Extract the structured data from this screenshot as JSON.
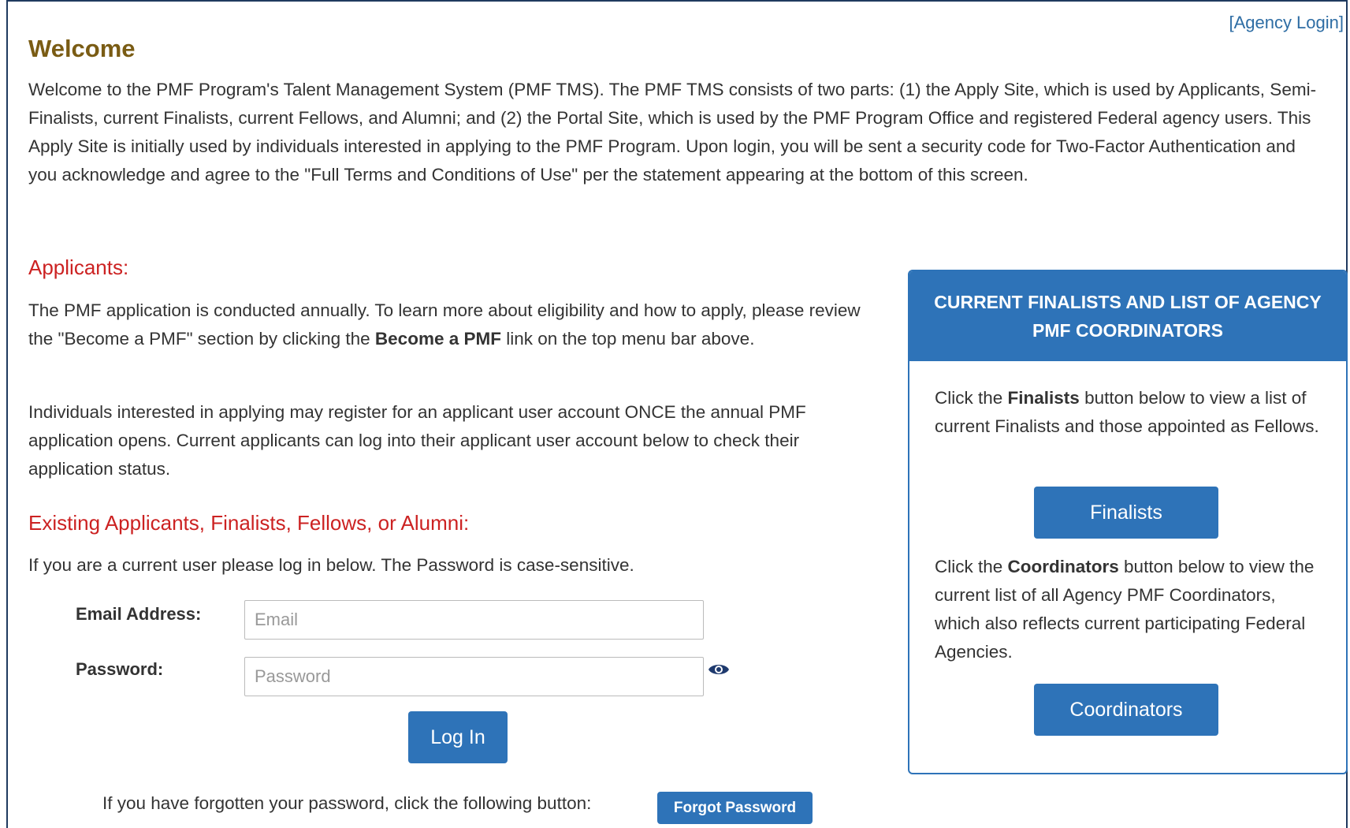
{
  "header": {
    "agency_login": "[Agency Login]"
  },
  "welcome": {
    "title": "Welcome",
    "body": "Welcome to the PMF Program's Talent Management System (PMF TMS). The PMF TMS consists of two parts: (1) the Apply Site, which is used by Applicants, Semi-Finalists, current Finalists, current Fellows, and Alumni; and (2) the Portal Site, which is used by the PMF Program Office and registered Federal agency users. This Apply Site is initially used by individuals interested in applying to the PMF Program. Upon login, you will be sent a security code for Two-Factor Authentication and you acknowledge and agree to the \"Full Terms and Conditions of Use\" per the statement appearing at the bottom of this screen."
  },
  "applicants": {
    "heading": "Applicants:",
    "para1_before": "The PMF application is conducted annually. To learn more about eligibility and how to apply, please review the \"Become a PMF\" section by clicking the ",
    "para1_bold": "Become a PMF",
    "para1_after": " link on the top menu bar above.",
    "para2": "Individuals interested in applying may register for an applicant user account ONCE the annual PMF application opens. Current applicants can log into their applicant user account below to check their application status."
  },
  "existing": {
    "heading": "Existing Applicants, Finalists, Fellows, or Alumni:",
    "instruction": "If you are a current user please log in below. The Password is case-sensitive."
  },
  "login_form": {
    "email_label": "Email Address:",
    "email_placeholder": "Email",
    "email_value": "",
    "password_label": "Password:",
    "password_placeholder": "Password",
    "password_value": "",
    "show_password_icon": "eye-icon",
    "login_label": "Log In",
    "forgot_text": "If you have forgotten your password, click the following button:",
    "forgot_label": "Forgot Password"
  },
  "finalists_card": {
    "title": "CURRENT FINALISTS AND LIST OF AGENCY PMF COORDINATORS",
    "finalists_before": "Click the ",
    "finalists_bold": "Finalists",
    "finalists_after": " button below to view a list of current Finalists and those appointed as Fellows.",
    "finalists_button": "Finalists",
    "coordinators_before": "Click the ",
    "coordinators_bold": "Coordinators",
    "coordinators_after": " button below to view the current list of all Agency PMF Coordinators, which also reflects current participating Federal Agencies.",
    "coordinators_button": "Coordinators"
  },
  "colors": {
    "accent_blue": "#2e73b8",
    "heading_red": "#cc2222",
    "welcome_gold": "#7a5c14",
    "frame_navy": "#1f3a5f"
  }
}
